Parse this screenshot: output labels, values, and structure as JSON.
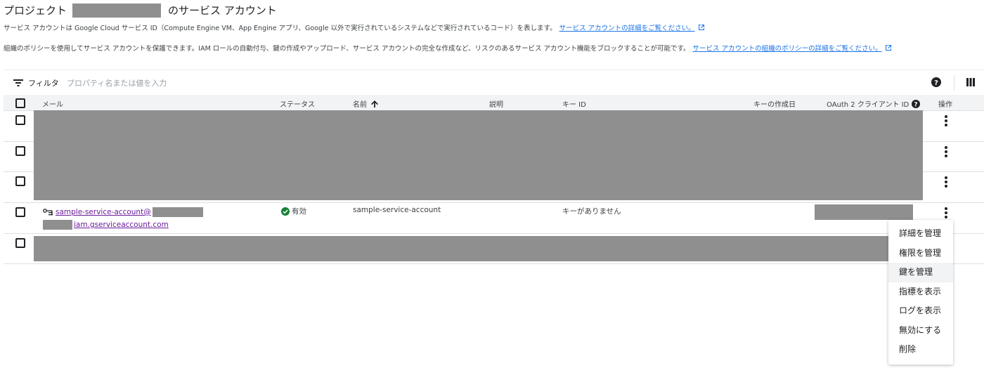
{
  "header": {
    "title_prefix": "プロジェクト",
    "title_suffix": "のサービス アカウント",
    "description": "サービス アカウントは Google Cloud サービス ID（Compute Engine VM、App Engine アプリ、Google 以外で実行されているシステムなどで実行されているコード）を表します。",
    "description_link": "サービス アカウントの詳細をご覧ください。",
    "policy_text": "組織のポリシーを使用してサービス アカウントを保護できます。IAM ロールの自動付与、鍵の作成やアップロード、サービス アカウントの完全な作成など、リスクのあるサービス アカウント機能をブロックすることが可能です。",
    "policy_link": "サービス アカウントの組織のポリシーの詳細をご覧ください。"
  },
  "filter": {
    "label": "フィルタ",
    "placeholder": "プロパティ名または値を入力"
  },
  "table": {
    "columns": {
      "email": "メール",
      "status": "ステータス",
      "name": "名前",
      "description": "説明",
      "key_id": "キー ID",
      "key_created": "キーの作成日",
      "oauth": "OAuth 2 クライアント ID",
      "actions": "操作"
    },
    "visible_row": {
      "email_line1": "sample-service-account@",
      "email_line2": "iam.gserviceaccount.com",
      "status": "有効",
      "name": "sample-service-account",
      "key_id": "キーがありません"
    }
  },
  "menu": {
    "items": [
      "詳細を管理",
      "権限を管理",
      "鍵を管理",
      "指標を表示",
      "ログを表示",
      "無効にする",
      "削除"
    ],
    "highlighted": "鍵を管理"
  },
  "colors": {
    "link": "#1a73e8",
    "visited_link": "#6a1b9a",
    "status_ok": "#188038",
    "redaction": "#8f8f8f"
  },
  "icons": [
    "external-link-icon",
    "filter-icon",
    "help-icon",
    "columns-icon",
    "sort-arrow-up-icon",
    "service-account-key-icon",
    "check-circle-icon",
    "more-vert-icon"
  ]
}
